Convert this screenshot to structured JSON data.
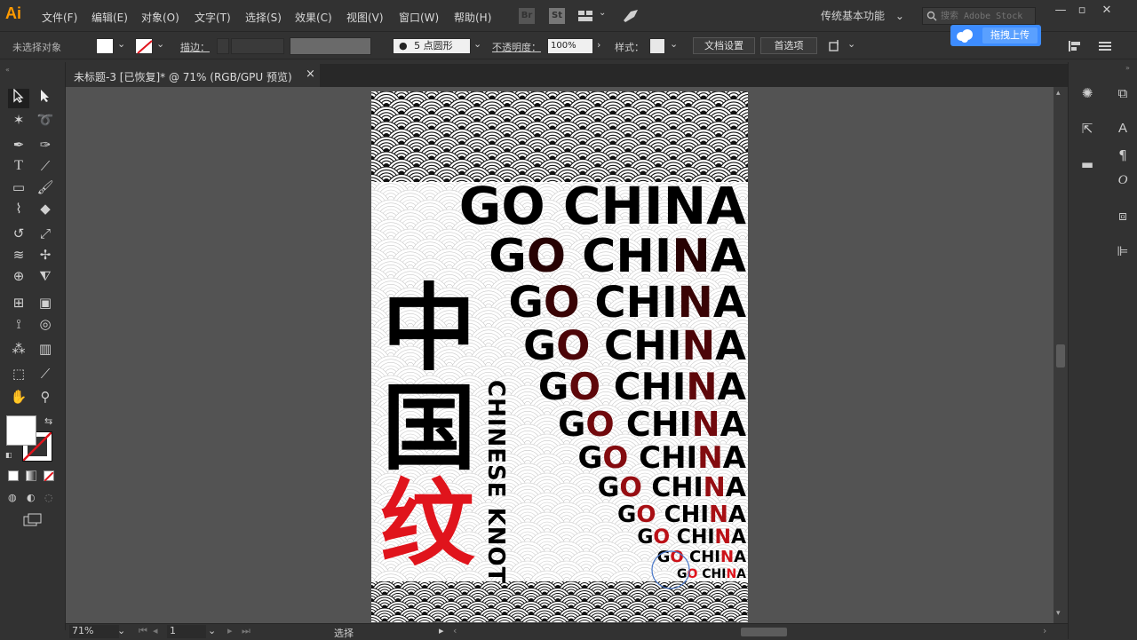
{
  "menubar": {
    "logo": "Ai",
    "items": [
      "文件(F)",
      "编辑(E)",
      "对象(O)",
      "文字(T)",
      "选择(S)",
      "效果(C)",
      "视图(V)",
      "窗口(W)",
      "帮助(H)"
    ],
    "br": "Br",
    "st": "St",
    "workspace": "传统基本功能",
    "stock_placeholder": "搜索 Adobe Stock"
  },
  "controlbar": {
    "selection": "未选择对象",
    "stroke_label": "描边：",
    "brush": "5 点圆形",
    "opacity_label": "不透明度：",
    "opacity_value": "100%",
    "style_label": "样式：",
    "doc_setup": "文档设置",
    "preferences": "首选项"
  },
  "upload": {
    "label": "拖拽上传"
  },
  "tab": {
    "title": "未标题-3 [已恢复]* @ 71% (RGB/GPU 预览)",
    "close": "×"
  },
  "artboard": {
    "lines": [
      "GO CHINA",
      "GO CHINA",
      "GO CHINA",
      "GO CHINA",
      "GO CHINA",
      "GO CHINA",
      "GO CHINA",
      "GO CHINA",
      "GO CHINA",
      "GO CHINA",
      "GO CHINA",
      "GO CHINA"
    ],
    "hanzi": [
      "中",
      "国",
      "纹"
    ],
    "vertical": "CHINESE KNOT"
  },
  "status": {
    "zoom": "71%",
    "page": "1",
    "mode": "选择"
  },
  "colors": {
    "accent_red": "#e0141c",
    "ui_bg": "#323232",
    "canvas_bg": "#535353",
    "upload_blue": "#3d8cff"
  }
}
